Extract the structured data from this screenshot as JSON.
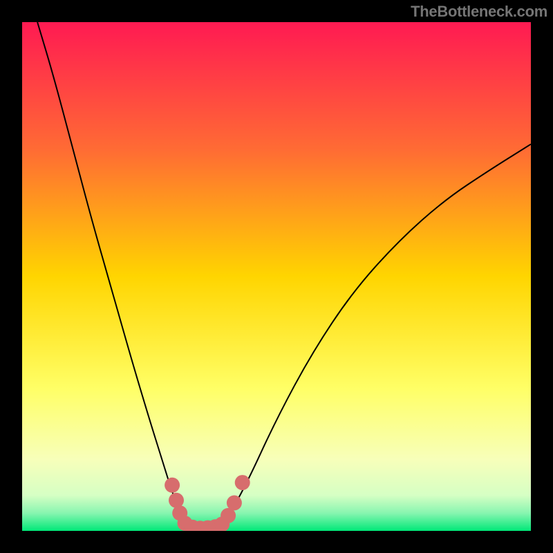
{
  "watermark": "TheBottleneck.com",
  "chart_data": {
    "type": "line",
    "title": "",
    "xlabel": "",
    "ylabel": "",
    "xlim": [
      0,
      100
    ],
    "ylim": [
      0,
      100
    ],
    "background_gradient": {
      "stops": [
        {
          "offset": 0.0,
          "color": "#ff1a52"
        },
        {
          "offset": 0.25,
          "color": "#ff6b34"
        },
        {
          "offset": 0.5,
          "color": "#ffd500"
        },
        {
          "offset": 0.72,
          "color": "#ffff66"
        },
        {
          "offset": 0.86,
          "color": "#f7ffba"
        },
        {
          "offset": 0.93,
          "color": "#d6ffc4"
        },
        {
          "offset": 0.965,
          "color": "#88f5b0"
        },
        {
          "offset": 1.0,
          "color": "#00e878"
        }
      ]
    },
    "series": [
      {
        "name": "curve",
        "color": "#000000",
        "stroke_width": 2,
        "points": [
          {
            "x": 3,
            "y": 100
          },
          {
            "x": 6,
            "y": 90
          },
          {
            "x": 10,
            "y": 75
          },
          {
            "x": 14,
            "y": 60
          },
          {
            "x": 18,
            "y": 46
          },
          {
            "x": 22,
            "y": 32
          },
          {
            "x": 25,
            "y": 22
          },
          {
            "x": 27.5,
            "y": 14
          },
          {
            "x": 30,
            "y": 6
          },
          {
            "x": 32,
            "y": 2
          },
          {
            "x": 34,
            "y": 0.5
          },
          {
            "x": 37,
            "y": 0.5
          },
          {
            "x": 40,
            "y": 2
          },
          {
            "x": 44,
            "y": 9
          },
          {
            "x": 50,
            "y": 22
          },
          {
            "x": 57,
            "y": 35
          },
          {
            "x": 65,
            "y": 47
          },
          {
            "x": 74,
            "y": 57
          },
          {
            "x": 83,
            "y": 65
          },
          {
            "x": 92,
            "y": 71
          },
          {
            "x": 100,
            "y": 76
          }
        ]
      },
      {
        "name": "markers",
        "type": "scatter",
        "color": "#d76d6d",
        "marker_radius_percent": 1.5,
        "points": [
          {
            "x": 29.5,
            "y": 9
          },
          {
            "x": 30.3,
            "y": 6
          },
          {
            "x": 31,
            "y": 3.5
          },
          {
            "x": 32,
            "y": 1.5
          },
          {
            "x": 33.5,
            "y": 0.7
          },
          {
            "x": 35,
            "y": 0.5
          },
          {
            "x": 36.5,
            "y": 0.6
          },
          {
            "x": 38,
            "y": 0.8
          },
          {
            "x": 39.3,
            "y": 1.3
          },
          {
            "x": 40.5,
            "y": 3
          },
          {
            "x": 41.7,
            "y": 5.5
          },
          {
            "x": 43.3,
            "y": 9.5
          }
        ]
      }
    ]
  }
}
